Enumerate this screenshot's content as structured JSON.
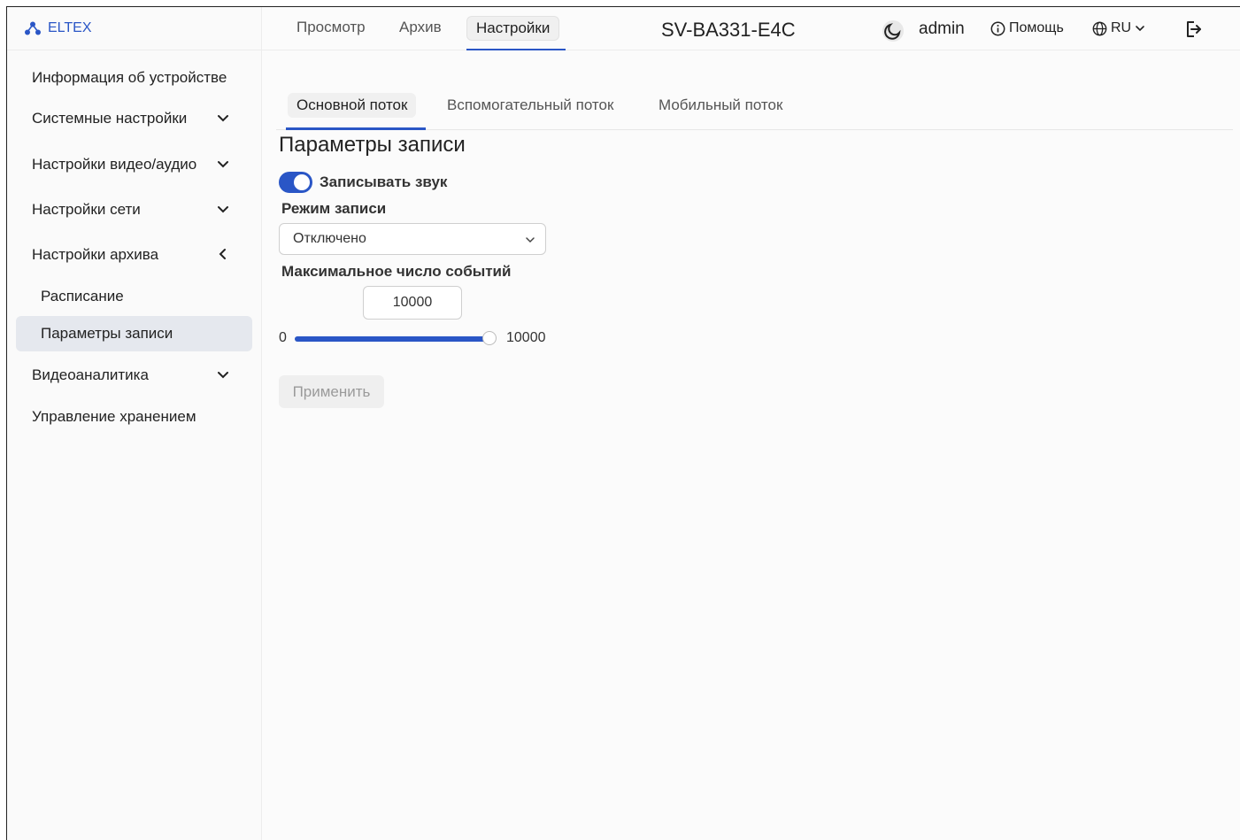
{
  "brand": {
    "name": "ELTEX",
    "accent": "#2a56c6"
  },
  "top_tabs": [
    {
      "label": "Просмотр"
    },
    {
      "label": "Архив"
    },
    {
      "label": "Настройки",
      "active": true
    }
  ],
  "device_name": "SV-BA331-E4C",
  "user": "admin",
  "help_label": "Помощь",
  "language": "RU",
  "sidebar": {
    "items": [
      {
        "label": "Информация об устройстве"
      },
      {
        "label": "Системные настройки",
        "icon": "chevron-down-icon"
      },
      {
        "label": "Настройки видео/аудио",
        "icon": "chevron-down-icon"
      },
      {
        "label": "Настройки сети",
        "icon": "chevron-down-icon"
      },
      {
        "label": "Настройки архива",
        "icon": "chevron-left-icon"
      },
      {
        "label": "Расписание"
      },
      {
        "label": "Параметры записи",
        "active": true
      },
      {
        "label": "Видеоаналитика",
        "icon": "chevron-down-icon"
      },
      {
        "label": "Управление хранением"
      }
    ]
  },
  "sub_tabs": [
    {
      "label": "Основной поток",
      "active": true
    },
    {
      "label": "Вспомогательный поток"
    },
    {
      "label": "Мобильный поток"
    }
  ],
  "form": {
    "title": "Параметры записи",
    "record_sound_label": "Записывать звук",
    "record_sound_enabled": true,
    "mode_label": "Режим записи",
    "mode_value": "Отключено",
    "max_events_label": "Максимальное число событий",
    "max_events_value": "10000",
    "slider_min": "0",
    "slider_max": "10000",
    "slider_fraction": 1.0,
    "apply_label": "Применить"
  }
}
